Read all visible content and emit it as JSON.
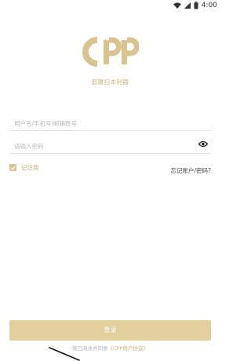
{
  "status_bar": {
    "time": "4:00",
    "icons": [
      "wifi-icon",
      "cell-signal-icon",
      "battery-icon"
    ]
  },
  "brand": {
    "logo_text": "CPP",
    "tagline": "逛展扫本利器",
    "accent_color": "#d9c48f"
  },
  "login_form": {
    "username_placeholder": "用户名/手机号/邮箱账号",
    "password_placeholder": "请输入密码",
    "show_password_icon": "eye-icon",
    "remember_label": "记住我",
    "remember_checked": true,
    "forgot_link": "忘记账户/密码?",
    "submit_label": "登录"
  },
  "agreement": {
    "prefix": "我已阅读并同意",
    "link": "《CPP用户协议》"
  }
}
